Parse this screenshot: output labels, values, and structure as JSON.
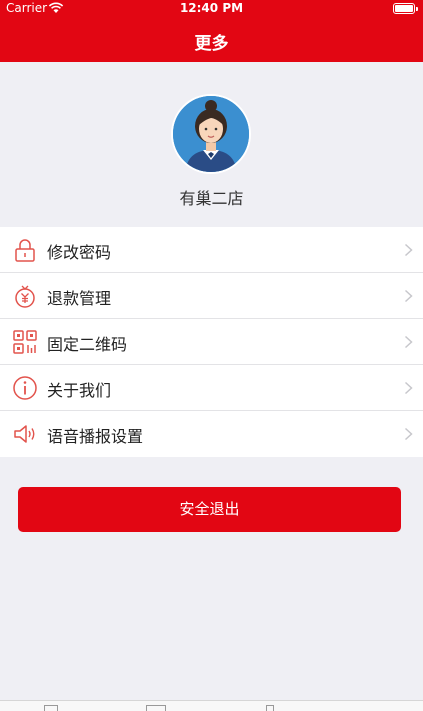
{
  "status_bar": {
    "carrier": "Carrier",
    "time": "12:40 PM"
  },
  "nav": {
    "title": "更多"
  },
  "profile": {
    "store_name": "有巢二店"
  },
  "menu": {
    "items": [
      {
        "label": "修改密码",
        "icon": "lock-icon"
      },
      {
        "label": "退款管理",
        "icon": "refund-icon"
      },
      {
        "label": "固定二维码",
        "icon": "qr-code-icon"
      },
      {
        "label": "关于我们",
        "icon": "info-icon"
      },
      {
        "label": "语音播报设置",
        "icon": "speaker-icon"
      }
    ]
  },
  "logout": {
    "label": "安全退出"
  },
  "colors": {
    "brand": "#e20613",
    "background": "#efeff4"
  }
}
